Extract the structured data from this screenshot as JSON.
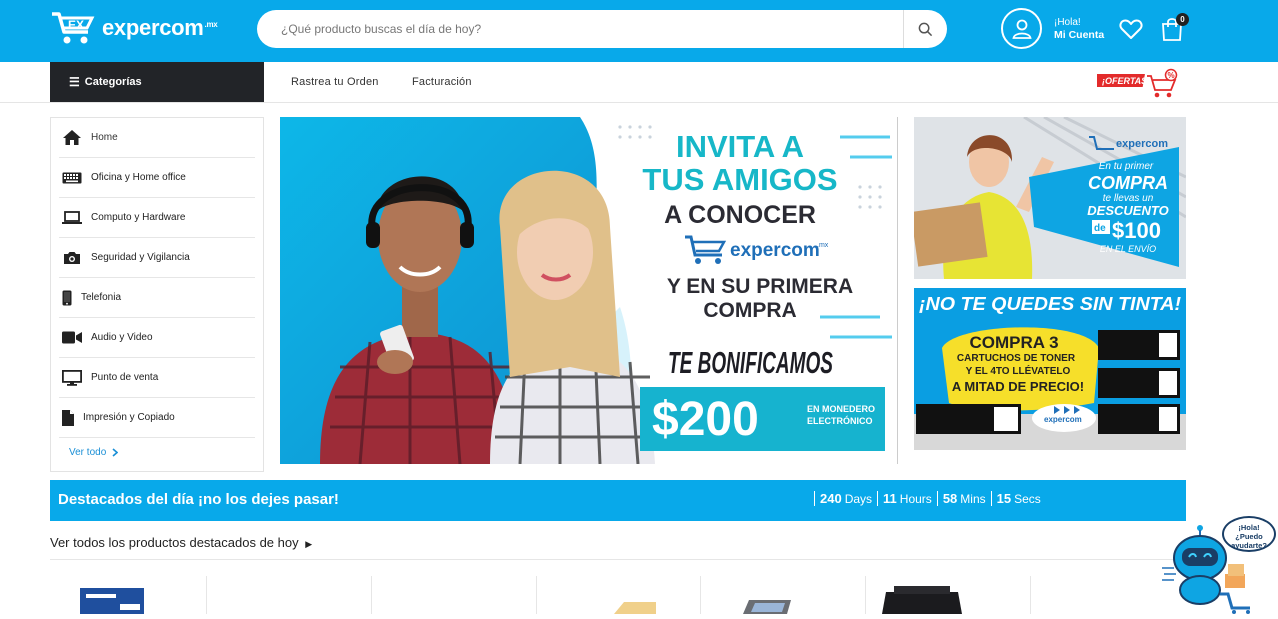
{
  "header": {
    "logo_text": "expercom",
    "logo_sup": ".mx",
    "search_placeholder": "¿Qué producto buscas el día de hoy?",
    "greeting": "¡Hola!",
    "account_label": "Mi Cuenta",
    "cart_count": "0"
  },
  "nav": {
    "categories_label": "Categorías",
    "links": [
      "Rastrea tu Orden",
      "Facturación"
    ],
    "ofertas_label": "¡OFERTAS!"
  },
  "sidebar": {
    "items": [
      {
        "label": "Home",
        "icon": "home-icon"
      },
      {
        "label": "Oficina y Home office",
        "icon": "keyboard-icon"
      },
      {
        "label": "Computo y Hardware",
        "icon": "laptop-icon"
      },
      {
        "label": "Seguridad y Vigilancia",
        "icon": "camera-icon"
      },
      {
        "label": "Telefonia",
        "icon": "phone-icon"
      },
      {
        "label": "Audio y Video",
        "icon": "video-icon"
      },
      {
        "label": "Punto de venta",
        "icon": "monitor-icon"
      },
      {
        "label": "Impresión y Copiado",
        "icon": "document-icon"
      }
    ],
    "see_all": "Ver todo"
  },
  "hero": {
    "line1": "INVITA A",
    "line2": "TUS AMIGOS",
    "line3": "A CONOCER",
    "brand": "expercom",
    "brand_sup": ".mx",
    "line4": "Y EN SU PRIMERA",
    "line5": "COMPRA",
    "line6": "TE BONIFICAMOS",
    "amount": "$200",
    "amount_note1": "EN MONEDERO",
    "amount_note2": "ELECTRÓNICO"
  },
  "banner1": {
    "brand": "expercom",
    "t1": "En tu primer",
    "t2": "COMPRA",
    "t3": "te llevas un",
    "t4": "DESCUENTO",
    "t5": "de",
    "t6": "$100",
    "t7": "EN EL ENVÍO"
  },
  "banner2": {
    "title": "¡NO TE QUEDES SIN TINTA!",
    "t1": "COMPRA 3",
    "t2": "CARTUCHOS DE TONER",
    "t3": "Y EL 4TO LLÉVATELO",
    "t4": "A MITAD DE PRECIO!",
    "brand": "expercom"
  },
  "promo": {
    "title": "Destacados del día ¡no los dejes pasar!",
    "countdown": [
      {
        "value": "240",
        "unit": "Days"
      },
      {
        "value": "11",
        "unit": "Hours"
      },
      {
        "value": "58",
        "unit": "Mins"
      },
      {
        "value": "15",
        "unit": "Secs"
      }
    ]
  },
  "featured": {
    "link": "Ver todos los productos destacados de hoy"
  },
  "chat": {
    "bubble1": "¡Hola!",
    "bubble2": "¿Puedo",
    "bubble3": "ayudarte?"
  },
  "colors": {
    "brand_blue": "#08a9ea",
    "dark": "#222428",
    "link_blue": "#1a8fd6",
    "hero_teal": "#16b3cf"
  }
}
